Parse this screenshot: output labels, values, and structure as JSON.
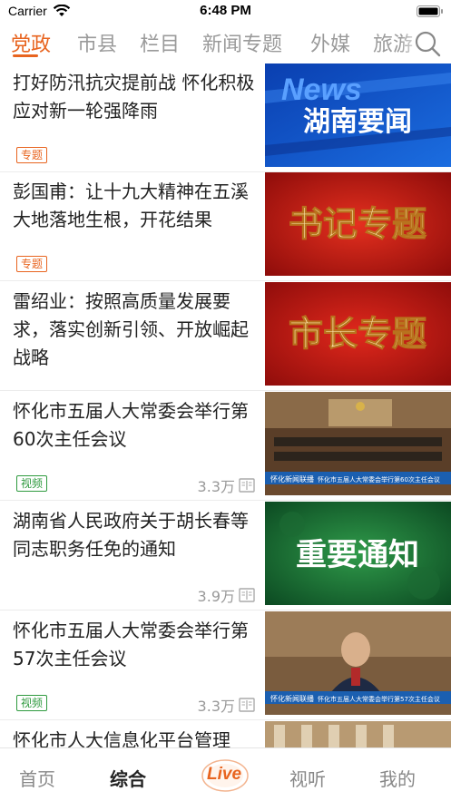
{
  "status": {
    "carrier": "Carrier",
    "time": "6:48 PM"
  },
  "channels": [
    "党政",
    "市县",
    "栏目",
    "新闻专题",
    "外媒",
    "旅游"
  ],
  "active_channel": "党政",
  "colors": {
    "accent": "#e8641f",
    "video_tag": "#2e9a3e"
  },
  "items": [
    {
      "title": "打好防汛抗灾提前战 怀化积极应对新一轮强降雨",
      "tag": "专题",
      "tag_type": "special",
      "views": "",
      "thumb": "湖南要闻"
    },
    {
      "title": "彭国甫：让十九大精神在五溪大地落地生根，开花结果",
      "tag": "专题",
      "tag_type": "special",
      "views": "",
      "thumb": "书记专题"
    },
    {
      "title": "雷绍业：按照高质量发展要求，落实创新引领、开放崛起战略",
      "tag": "",
      "tag_type": "",
      "views": "",
      "thumb": "市长专题"
    },
    {
      "title": "怀化市五届人大常委会举行第60次主任会议",
      "tag": "视频",
      "tag_type": "video",
      "views": "3.3万",
      "thumb": "怀化市五届人大常委会举行第60次主任会议"
    },
    {
      "title": "湖南省人民政府关于胡长春等同志职务任免的通知",
      "tag": "",
      "tag_type": "",
      "views": "3.9万",
      "thumb": "重要通知"
    },
    {
      "title": "怀化市五届人大常委会举行第57次主任会议",
      "tag": "视频",
      "tag_type": "video",
      "views": "3.3万",
      "thumb": "怀化市五届人大常委会举行第57次主任会议"
    },
    {
      "title": "怀化市人大信息化平台管理",
      "tag": "",
      "tag_type": "",
      "views": "",
      "thumb": ""
    }
  ],
  "thumb_extra": {
    "news_word": "News",
    "station_logo": "怀化新闻联播"
  },
  "icons": {
    "wifi": "wifi-icon",
    "battery": "battery-icon",
    "search": "search-icon",
    "comment": "comment-icon"
  },
  "nav": [
    "首页",
    "综合",
    "Live",
    "视听",
    "我的"
  ],
  "active_nav": "综合"
}
